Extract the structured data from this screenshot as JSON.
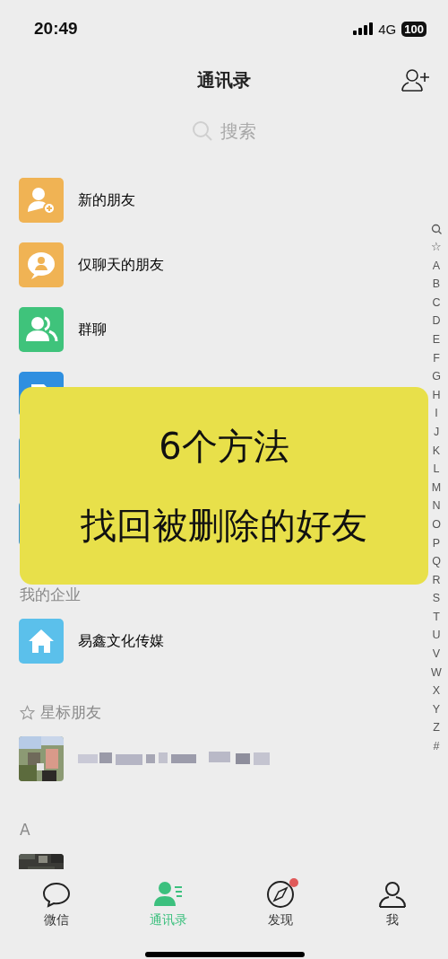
{
  "status_bar": {
    "time": "20:49",
    "network": "4G",
    "battery": "100"
  },
  "header": {
    "title": "通讯录"
  },
  "search": {
    "placeholder": "搜索"
  },
  "feature_rows": [
    {
      "label": "新的朋友",
      "kind": "new-friends"
    },
    {
      "label": "仅聊天的朋友",
      "kind": "chat-only"
    },
    {
      "label": "群聊",
      "kind": "group"
    },
    {
      "kind": "tags"
    },
    {
      "kind": "official"
    },
    {
      "kind": "service"
    }
  ],
  "sections": [
    {
      "header": "我的企业",
      "starred": false,
      "rows": [
        {
          "label": "易鑫文化传媒",
          "kind": "enterprise"
        }
      ]
    },
    {
      "header": "星标朋友",
      "starred": true,
      "rows": [
        {
          "kind": "blurred"
        }
      ]
    },
    {
      "header": "A",
      "starred": false
    }
  ],
  "overlay": {
    "lines": [
      "6个方法",
      "找回被删除的好友"
    ]
  },
  "index": [
    "☆",
    "A",
    "B",
    "C",
    "D",
    "E",
    "F",
    "G",
    "H",
    "I",
    "J",
    "K",
    "L",
    "M",
    "N",
    "O",
    "P",
    "Q",
    "R",
    "S",
    "T",
    "U",
    "V",
    "W",
    "X",
    "Y",
    "Z",
    "#"
  ],
  "tabs": [
    {
      "label": "微信",
      "kind": "chats",
      "selected": false,
      "badge": false
    },
    {
      "label": "通讯录",
      "kind": "contacts",
      "selected": true,
      "badge": false
    },
    {
      "label": "发现",
      "kind": "discover",
      "selected": false,
      "badge": true
    },
    {
      "label": "我",
      "kind": "me",
      "selected": false,
      "badge": false
    }
  ]
}
